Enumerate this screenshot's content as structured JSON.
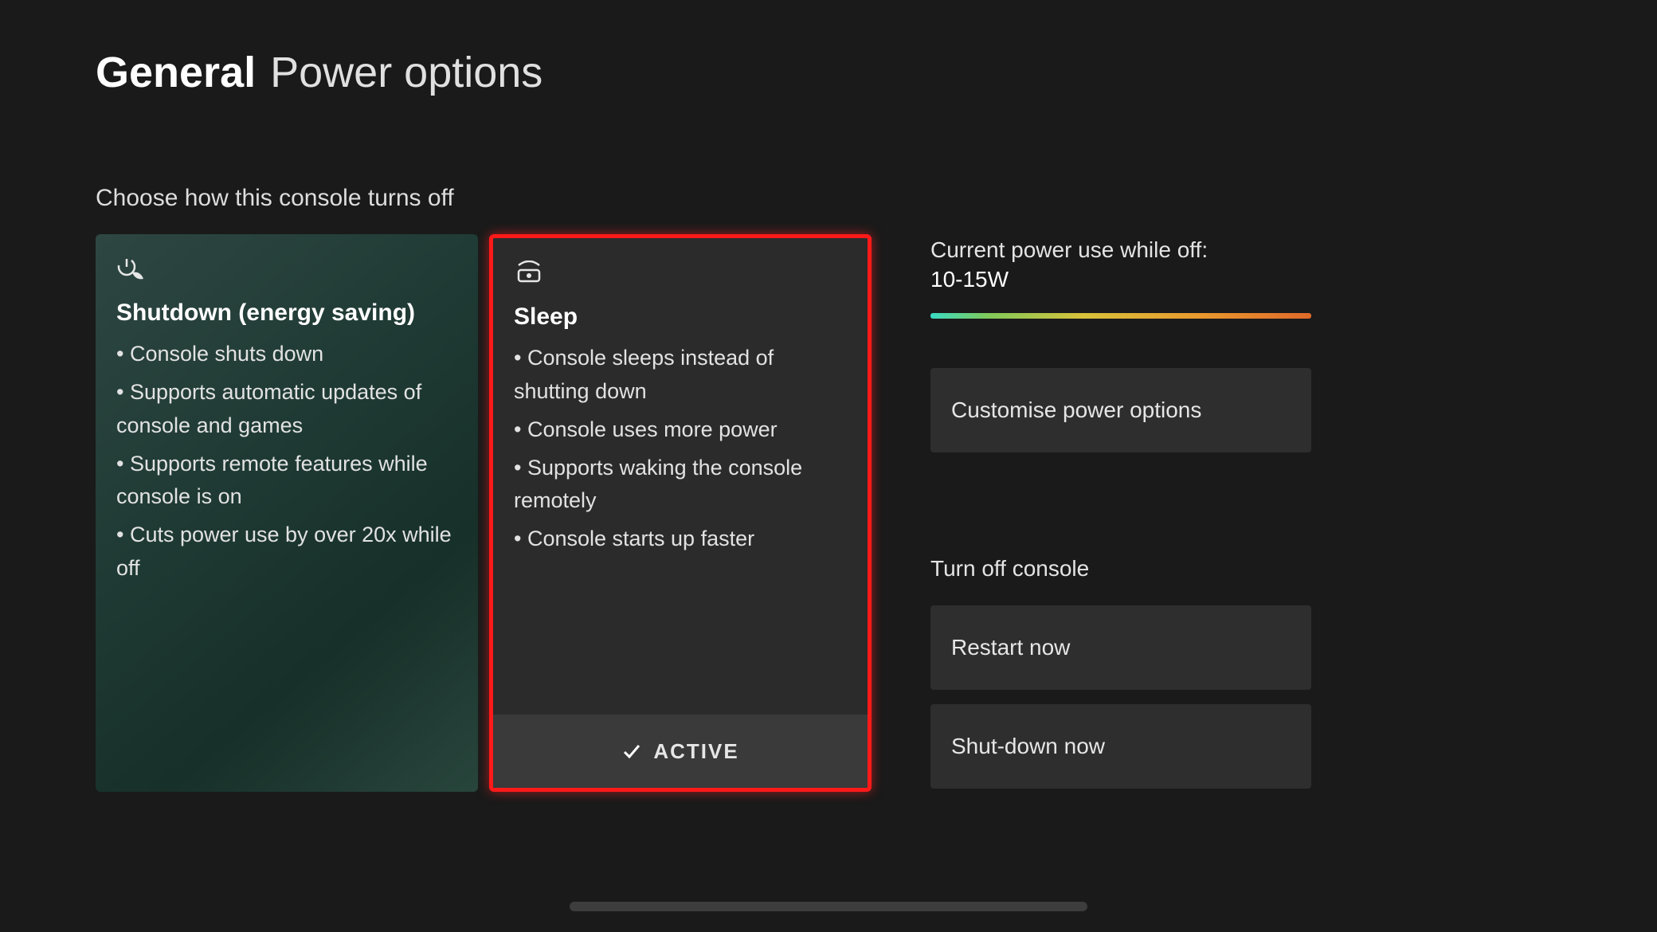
{
  "header": {
    "category": "General",
    "page": "Power options"
  },
  "subhead": "Choose how this console turns off",
  "cards": {
    "shutdown": {
      "title": "Shutdown (energy saving)",
      "bullets": [
        "Console shuts down",
        "Supports automatic updates of console and games",
        "Supports remote features while console is on",
        "Cuts power use by over 20x while off"
      ]
    },
    "sleep": {
      "title": "Sleep",
      "bullets": [
        "Console sleeps instead of shutting down",
        "Console uses more power",
        "Supports waking the console remotely",
        "Console starts up faster"
      ],
      "active_label": "ACTIVE"
    }
  },
  "sidebar": {
    "power_use_label": "Current power use while off:",
    "power_use_value": "10-15W",
    "customise_label": "Customise power options",
    "turn_off_label": "Turn off console",
    "restart_label": "Restart now",
    "shutdown_label": "Shut-down now"
  }
}
